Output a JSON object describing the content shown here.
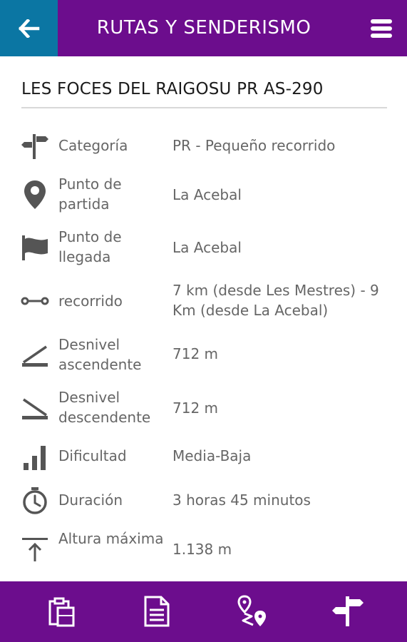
{
  "header": {
    "title": "RUTAS Y SENDERISMO",
    "back_icon": "arrow-left-icon",
    "menu_icon": "hamburger-menu-icon",
    "colors": {
      "bar": "#6c0d8d",
      "back": "#0b76a3"
    }
  },
  "route": {
    "title": "LES FOCES DEL RAIGOSU PR AS-290"
  },
  "details": [
    {
      "icon": "signpost-icon",
      "label": "Categoría",
      "value": "PR - Pequeño recorrido"
    },
    {
      "icon": "map-pin-icon",
      "label": "Punto de partida",
      "value": "La Acebal"
    },
    {
      "icon": "flag-icon",
      "label": "Punto de llegada",
      "value": "La Acebal"
    },
    {
      "icon": "distance-icon",
      "label": "recorrido",
      "value": "7 km (desde Les Mestres) - 9 Km (desde La Acebal)"
    },
    {
      "icon": "ascent-icon",
      "label": "Desnivel ascendente",
      "value": "712 m"
    },
    {
      "icon": "descent-icon",
      "label": "Desnivel descendente",
      "value": "712 m"
    },
    {
      "icon": "difficulty-bars-icon",
      "label": "Dificultad",
      "value": "Media-Baja"
    },
    {
      "icon": "stopwatch-icon",
      "label": "Duración",
      "value": "3 horas 45 minutos"
    },
    {
      "icon": "max-altitude-icon",
      "label": "Altura máxima",
      "value": "1.138 m"
    }
  ],
  "footer": {
    "buttons": [
      "clipboard-icon",
      "document-icon",
      "route-map-icon",
      "signpost-icon"
    ]
  }
}
